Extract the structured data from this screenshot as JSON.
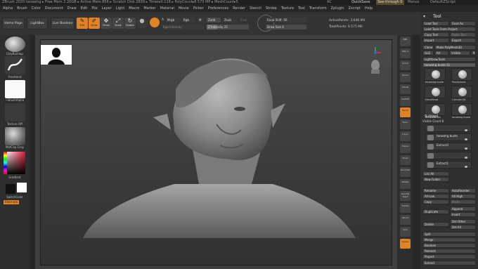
{
  "titlebar": {
    "text": "ZBrush 2020  tanwehg  ▸ Free Mem 2.20GB ▸ Active Mem 856 ▸ Scratch Disk 2839 ▸ Timer▸0.118 ▸ PolyCount▸8.573 MP ▸ MeshCount▸5",
    "ac": "AC",
    "quicksave": "QuickSave",
    "seethrough": "See-through 0",
    "menus": "Menus",
    "script": "DefaultZScript"
  },
  "menubar": {
    "items": [
      "Alpha",
      "Brush",
      "Color",
      "Document",
      "Draw",
      "Edit",
      "File",
      "Layer",
      "Light",
      "Macro",
      "Marker",
      "Material",
      "Movie",
      "Picker",
      "Preferences",
      "Render",
      "Stencil",
      "Stroke",
      "Texture",
      "Tool",
      "Transform",
      "Zplugin",
      "Zscript",
      "Help"
    ]
  },
  "toolbar": {
    "home_page": "Home Page",
    "lightbox": "LightBox",
    "live_boolean": "Live Boolean",
    "edit": "Edit",
    "draw": "Draw",
    "move": "Move",
    "scale": "Scale",
    "rotate": "Rotate",
    "a_label": "A",
    "mrgb": "Mrgb",
    "rgb": "Rgb",
    "m_label": "M",
    "zadd": "Zadd",
    "zsub": "Zsub",
    "zcut": "Zcut",
    "rgb_intensity": "Rgb Intensity",
    "z_intensity": "Z Intensity 25",
    "focal_shift": "Focal Shift -56",
    "draw_size": "Draw Size 4",
    "active_points": "ActivePoints: 3,646 Mil",
    "total_points": "TotalPoints: 8.575 Mil",
    "z_intensity_level": 0.25
  },
  "leftshelf": {
    "brush": "ClayBuildup",
    "stroke": "FreeHand",
    "alpha": "~BrushAlpha",
    "texture": "Texture Off",
    "material": "MatCap Gray",
    "gradient": "Gradient",
    "switchcolor": "SwitchColor",
    "alternate": "Alternate"
  },
  "rightshelf": {
    "labels": [
      "BPR",
      "SPix 3",
      "Scroll",
      "Zoom",
      "Actual",
      "AAHalf",
      "Persp",
      "Floor",
      "L.Sym",
      "Frame",
      "Move",
      "Zoom3D",
      "Rotate",
      "Line Fill PolyF",
      "Transp",
      "Ghost",
      "Solo",
      "Xpose"
    ]
  },
  "rightpanel": {
    "tool": "Tool",
    "load_tool": "Load Tool",
    "save_as": "Save As",
    "load_tools_from_project": "Load Tools From Project",
    "copy_tool": "Copy Tool",
    "paste_tool": "Paste Tool",
    "import": "Import",
    "export": "Export",
    "clone": "Clone",
    "make_polymesh": "Make PolyMesh3D",
    "goz": "GoZ",
    "all": "All",
    "visible": "Visible",
    "r": "R",
    "lightbox_tools": "Lightbox▸Tools",
    "current_tool": "tanwehg buste  51",
    "thumbs": [
      "tanwehg buste",
      "PolySphere",
      "DecoHead",
      "Cylinder3D",
      "SimpleBrush",
      "tanwehg buste"
    ],
    "subtool": "Subtool",
    "visible_count": "Visible Count 8",
    "subtools": [
      "",
      "tanwehg buste",
      "Extract3",
      "",
      "Extract1"
    ],
    "list_all": "List All",
    "new_folder": "New Folder",
    "rename": "Rename",
    "autoreorder": "AutoReorder",
    "all_low": "All Low",
    "all_high": "All High",
    "copy": "Copy",
    "paste": "Paste",
    "duplicate": "Duplicate",
    "append": "Append",
    "insert": "Insert",
    "delete": "Delete",
    "del_other": "Del Other",
    "del_all": "Del All",
    "split": "Split",
    "merge": "Merge",
    "boolean": "Boolean",
    "remesh": "Remesh",
    "project": "Project",
    "extract": "Extract"
  },
  "colors": {
    "accent": "#e08326",
    "bg": "#2b2b2b"
  }
}
